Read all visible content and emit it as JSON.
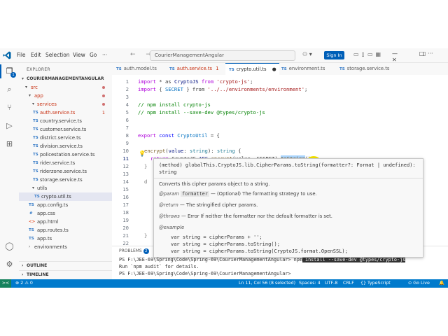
{
  "titlebar": {
    "menus": [
      "File",
      "Edit",
      "Selection",
      "View",
      "Go",
      "···"
    ],
    "search_text": "CourierManagementAngular",
    "signin_label": "Sign In",
    "nav_arrows": "← →",
    "window_controls": "— ▢ ✕"
  },
  "activity": {
    "badge": "1"
  },
  "sidebar": {
    "title": "EXPLORER",
    "project": "COURIERMANAGEMENTANGULAR",
    "src": "src",
    "app": "app",
    "services": "services",
    "files": [
      {
        "name": "auth.service.ts",
        "badge": "1",
        "error": true
      },
      {
        "name": "country.service.ts"
      },
      {
        "name": "customer.service.ts"
      },
      {
        "name": "district.service.ts"
      },
      {
        "name": "division.service.ts"
      },
      {
        "name": "policestation.service.ts"
      },
      {
        "name": "rider.service.ts"
      },
      {
        "name": "riderzone.service.ts"
      },
      {
        "name": "storage.service.ts"
      }
    ],
    "utils": "utils",
    "utils_file": "crypto.util.ts",
    "app_files": [
      {
        "name": "app.config.ts",
        "icon": "TS"
      },
      {
        "name": "app.css",
        "icon": "#"
      },
      {
        "name": "app.html",
        "icon": "<>"
      },
      {
        "name": "app.routes.ts",
        "icon": "TS"
      },
      {
        "name": "app.ts",
        "icon": "TS"
      }
    ],
    "environments": "environments",
    "outline": "OUTLINE",
    "timeline": "TIMELINE"
  },
  "tabs": [
    {
      "label": "auth.model.ts",
      "active": false
    },
    {
      "label": "auth.service.ts",
      "suffix": "1",
      "error": true,
      "active": false
    },
    {
      "label": "crypto.util.ts",
      "active": true,
      "modified": "●"
    },
    {
      "label": "environment.ts",
      "active": false
    },
    {
      "label": "storage.service.ts",
      "active": false
    }
  ],
  "editor": {
    "line_numbers": [
      "1",
      "2",
      "3",
      "4",
      "5",
      "6",
      "7",
      "8",
      "9",
      "10",
      "11",
      "12",
      "13",
      "14",
      "15",
      "16",
      "17",
      "18",
      "19",
      "20",
      "21",
      "22"
    ],
    "current_line": "11"
  },
  "code": {
    "l1": {
      "a": "import",
      "b": " * as ",
      "c": "CryptoJS",
      "d": " from ",
      "e": "'crypto-js'",
      "f": ";"
    },
    "l2": {
      "a": "import",
      "b": " { ",
      "c": "SECRET",
      "d": " } from ",
      "e": "'../../environments/environment'",
      "f": ";"
    },
    "l4": "// npm install crypto-js",
    "l5": "// npm install --save-dev @types/crypto-js",
    "l8": {
      "a": "export",
      "b": " const ",
      "c": "CryptoUtil",
      "d": " = {"
    },
    "l10": {
      "a": "encrypt",
      "b": "(",
      "c": "value",
      "d": ": ",
      "e": "string",
      "f": "): ",
      "g": "string",
      "h": " {"
    },
    "l11": {
      "a": "return",
      "b": " CryptoJS.",
      "c": "AES",
      "d": ".",
      "e": "encrypt",
      "f": "(value, SECRET).",
      "g": "toString",
      "h": "();"
    }
  },
  "hover": {
    "signature": "(method) globalThis.CryptoJS.lib.CipherParams.toString(formatter?: Format | undefined): string",
    "description": "Converts this cipher params object to a string.",
    "param_tag": "@param",
    "param_name": "formatter",
    "param_desc": "— (Optional) The formatting strategy to use.",
    "return_tag": "@return",
    "return_desc": "— The stringified cipher params.",
    "throws_tag": "@throws",
    "throws_desc": "— Error If neither the formatter nor the default formatter is set.",
    "example_tag": "@example",
    "examples": [
      "var string = cipherParams + '';",
      "var string = cipherParams.toString();",
      "var string = cipherParams.toString(CryptoJS.format.OpenSSL);"
    ]
  },
  "panel": {
    "tab": "PROBLEMS",
    "badge": "2",
    "term1_a": "PS F:\\JEE-69\\Spring\\Code\\Spring-69\\CourierManagementAngular> npm",
    "term1_b": " install --save-dev @types/crypto-js",
    "term2": "Run `npm audit` for details.",
    "term3": "PS F:\\JEE-69\\Spring\\Code\\Spring-69\\CourierManagementAngular> "
  },
  "statusbar": {
    "remote": "><",
    "problems": "⊗ 2  ⚠ 0",
    "position": "Ln 11, Col 56 (8 selected)",
    "spaces": "Spaces: 4",
    "encoding": "UTF-8",
    "eol": "CRLF",
    "language": "{} TypeScript",
    "golive": "⊙ Go Live",
    "bell": "🔔"
  },
  "colors": {
    "accent": "#005fb8",
    "statusbar": "#007acc",
    "cursor_highlight": "#f5e400"
  }
}
